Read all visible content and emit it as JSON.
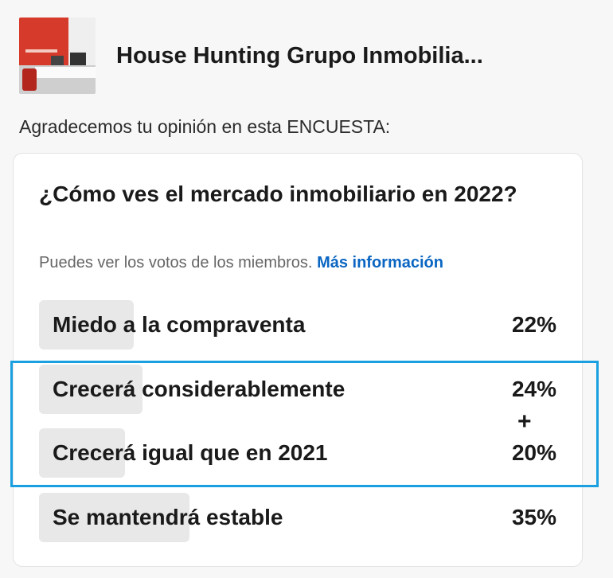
{
  "header": {
    "org_name": "House Hunting Grupo Inmobilia..."
  },
  "intro_text": "Agradecemos tu opinión en esta ENCUESTA:",
  "poll": {
    "question": "¿Cómo ves el mercado inmobiliario en 2022?",
    "visibility_text": "Puedes ver los votos de los miembros.",
    "more_info_label": "Más información",
    "options": [
      {
        "label": "Miedo a la compraventa",
        "percent_label": "22%",
        "percent": 22
      },
      {
        "label": "Crecerá considerablemente",
        "percent_label": "24%",
        "percent": 24
      },
      {
        "label": "Crecerá igual que en 2021",
        "percent_label": "20%",
        "percent": 20
      },
      {
        "label": "Se mantendrá estable",
        "percent_label": "35%",
        "percent": 35
      }
    ]
  },
  "annotation": {
    "plus_sign": "+",
    "highlight_color": "#1aa0e0"
  },
  "colors": {
    "link": "#0a66c2",
    "bar": "#e8e8e8"
  }
}
